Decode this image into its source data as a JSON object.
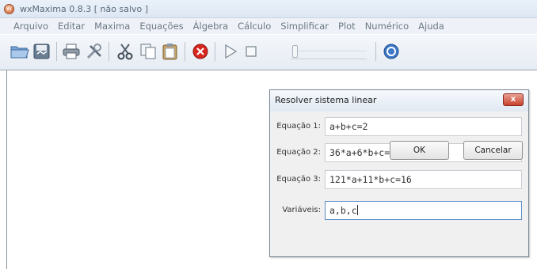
{
  "window": {
    "title": "wxMaxima 0.8.3 [ não salvo ]",
    "icon_glyph": "W"
  },
  "menu": [
    "Arquivo",
    "Editar",
    "Maxima",
    "Equações",
    "Álgebra",
    "Cálculo",
    "Simplificar",
    "Plot",
    "Numérico",
    "Ajuda"
  ],
  "toolbar": {
    "icons": [
      "open-folder-icon",
      "save-icon",
      "print-icon",
      "preferences-icon",
      "cut-icon",
      "copy-icon",
      "paste-icon",
      "interrupt-icon",
      "play-icon",
      "stop-icon",
      "animation-slider",
      "help-icon"
    ],
    "slider_position": 0.0
  },
  "dialog": {
    "title": "Resolver sistema linear",
    "close_label": "x",
    "fields": [
      {
        "label": "Equação 1:",
        "value": "a+b+c=2"
      },
      {
        "label": "Equação 2:",
        "value": "36*a+6*b+c=10"
      },
      {
        "label": "Equação 3:",
        "value": "121*a+11*b+c=16"
      },
      {
        "label": "Variáveis:",
        "value": "a,b,c"
      }
    ],
    "ok_label": "OK",
    "cancel_label": "Cancelar"
  },
  "colors": {
    "close_button": "#c9412c",
    "interrupt_red": "#d8261f",
    "help_blue": "#3c78c8"
  }
}
